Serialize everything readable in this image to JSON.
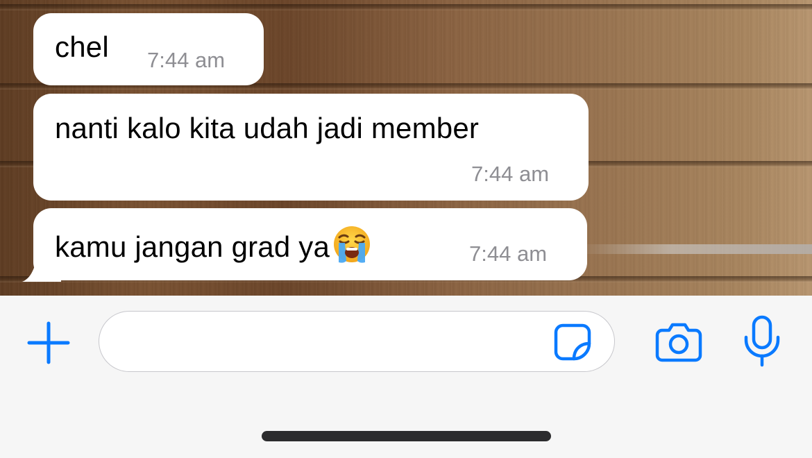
{
  "messages": [
    {
      "text": "chel",
      "time": "7:44 am"
    },
    {
      "text": "nanti kalo kita udah jadi member",
      "time": "7:44 am"
    },
    {
      "text": "kamu jangan grad ya",
      "emoji": "loudly-crying-face",
      "time": "7:44 am"
    }
  ],
  "composer": {
    "placeholder": "",
    "add_icon": "plus-icon",
    "sticker_icon": "sticker-icon",
    "camera_icon": "camera-icon",
    "mic_icon": "microphone-icon"
  },
  "colors": {
    "accent": "#0a7aff",
    "bubble": "#ffffff",
    "timestamp": "#8e8e93",
    "bar": "#f6f6f6"
  }
}
